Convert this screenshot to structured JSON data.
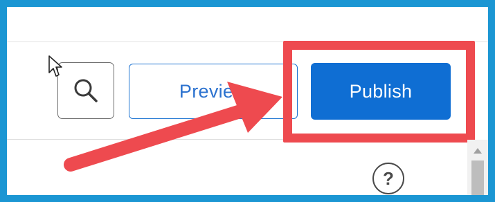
{
  "toolbar": {
    "search_icon": "search-icon",
    "preview_label": "Preview",
    "publish_label": "Publish"
  },
  "help": {
    "icon": "help-icon",
    "glyph": "?"
  },
  "colors": {
    "frame_border": "#1b96d3",
    "publish_bg": "#0f6ed3",
    "preview_text": "#2c72cf",
    "annotation_red": "#ee4a4f"
  }
}
